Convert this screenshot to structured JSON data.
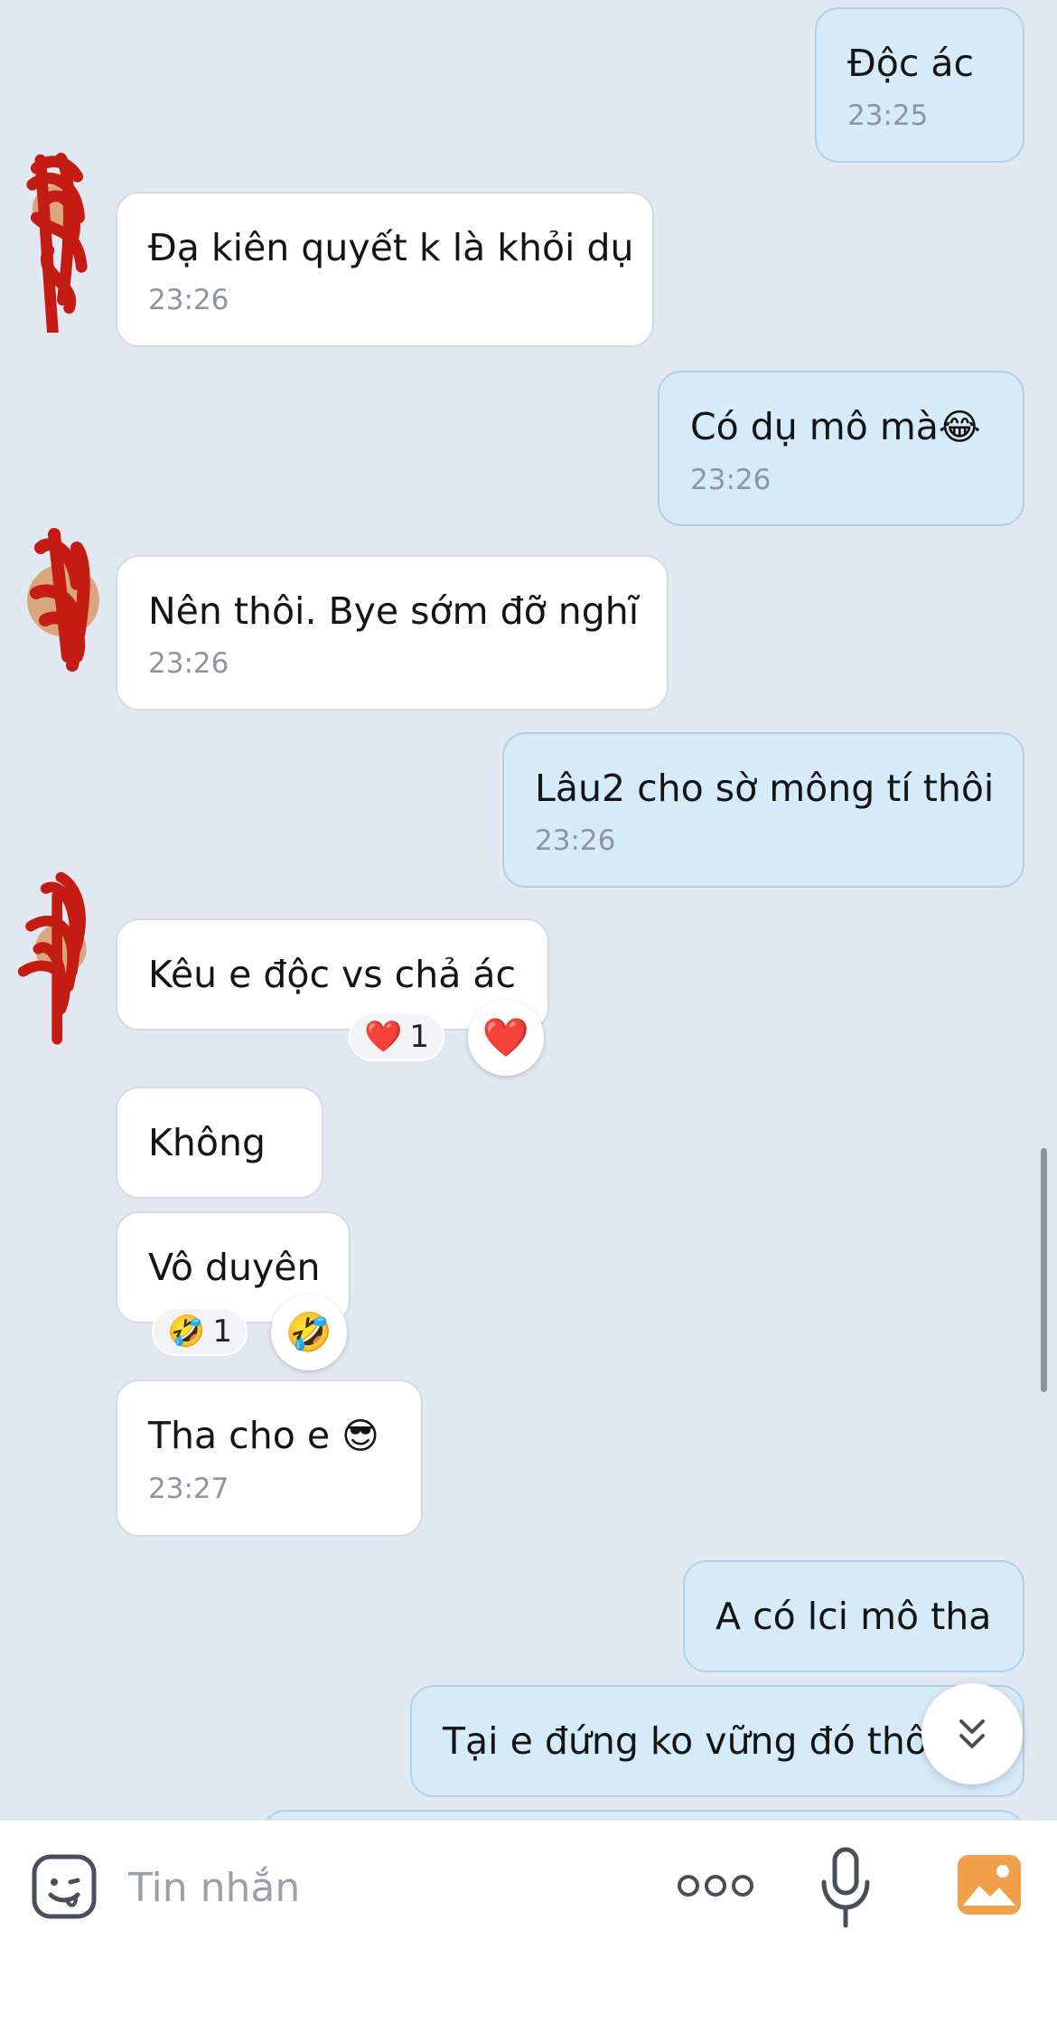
{
  "messages": [
    {
      "text": "Độc ác",
      "time": "23:25"
    },
    {
      "text": "Đạ kiên quyết k là khỏi dụ",
      "time": "23:26"
    },
    {
      "text": "Có dụ mô mà",
      "emoji": "😂",
      "time": "23:26"
    },
    {
      "text": "Nên thôi. Bye sớm đỡ nghĩ",
      "time": "23:26"
    },
    {
      "text": "Lâu2 cho sờ mông tí thôi",
      "time": "23:26"
    },
    {
      "text": "Kêu e độc vs chả ác",
      "reaction": {
        "emoji": "❤️",
        "count": "1",
        "button_emoji": "❤️"
      }
    },
    {
      "text": "Không"
    },
    {
      "text": "Vô duyên",
      "reaction": {
        "emoji": "🤣",
        "count": "1",
        "button_emoji": "🤣"
      }
    },
    {
      "text": "Tha cho e",
      "emoji": "😎",
      "time": "23:27"
    },
    {
      "text": "A có lci mô tha"
    },
    {
      "text": "Tại e đứng ko vững đó thô"
    }
  ],
  "input": {
    "placeholder": "Tin nhắn"
  },
  "icons": {
    "sticker": "sticker-face-icon",
    "more": "more-dots-icon",
    "mic": "microphone-icon",
    "image": "image-gallery-icon",
    "scroll_down": "double-chevron-down-icon"
  },
  "colors": {
    "background": "#e2e8f1",
    "incoming_bubble": "#ffffff",
    "outgoing_bubble": "#d6ebfa",
    "time_text": "#8f959d",
    "image_icon": "#f0a04a"
  }
}
